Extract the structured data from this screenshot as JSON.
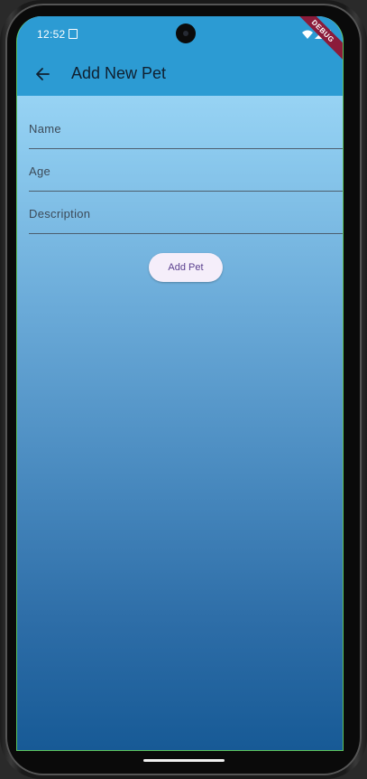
{
  "status_bar": {
    "time": "12:52"
  },
  "app_bar": {
    "title": "Add New Pet",
    "back_icon": "arrow-left-icon"
  },
  "debug_banner": "DEBUG",
  "form": {
    "fields": [
      {
        "label": "Name",
        "value": ""
      },
      {
        "label": "Age",
        "value": ""
      },
      {
        "label": "Description",
        "value": ""
      }
    ],
    "submit_label": "Add Pet"
  },
  "colors": {
    "app_bar": "#2c9bd3",
    "gradient_top": "#a8e0fc",
    "gradient_bottom": "#175a96",
    "button_bg": "#f5eefa",
    "button_text": "#5a3f8e"
  }
}
